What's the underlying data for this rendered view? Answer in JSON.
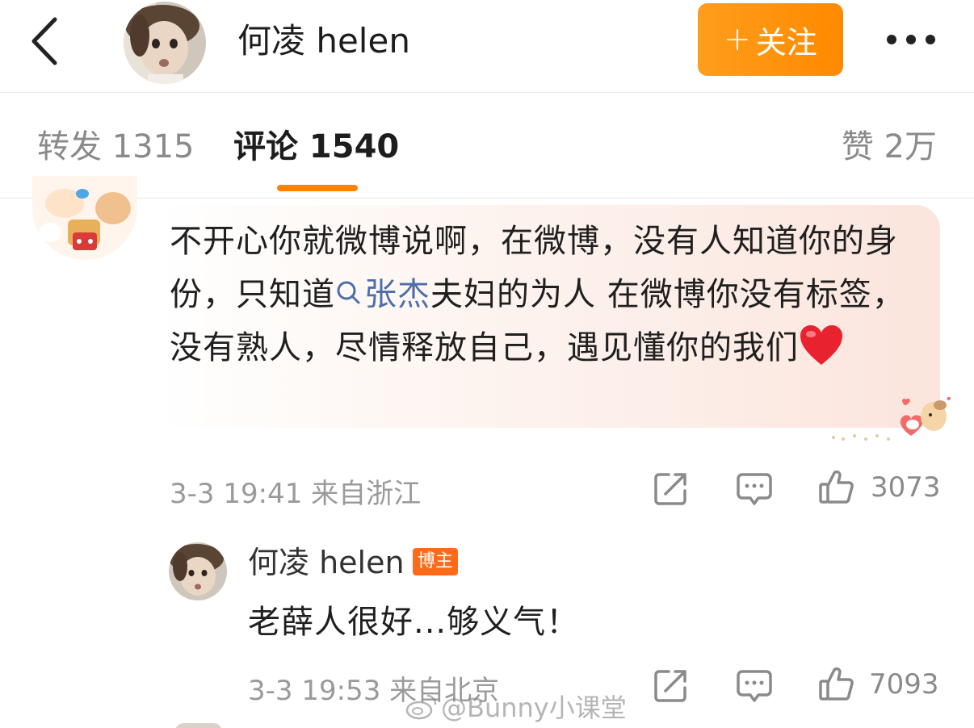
{
  "header": {
    "title": "何凌 helen",
    "follow_label": "关注",
    "follow_plus": "+",
    "back_icon": "chevron-left-icon",
    "more_icon": "more-dots-icon",
    "accent_color": "#ff8a00"
  },
  "tabs": {
    "repost": "转发 1315",
    "comment": "评论 1540",
    "likes": "赞 2万",
    "active": "comment"
  },
  "comment": {
    "text_before": "不开心你就微博说啊，在微博，没有人知道你的身份，只知道",
    "topic": "张杰",
    "text_after": "夫妇的为人  在微博你没有标签，没有熟人，尽情释放自己，遇见懂你的我们",
    "emoji": "heart-emoji",
    "meta": "3-3 19:41 来自浙江",
    "like_count": "3073"
  },
  "reply": {
    "name": "何凌 helen",
    "badge": "博主",
    "text": "老薛人很好...够义气！",
    "meta": "3-3 19:53 来自北京",
    "like_count": "7093"
  },
  "watermark": {
    "text": "@Bunny小课堂"
  }
}
